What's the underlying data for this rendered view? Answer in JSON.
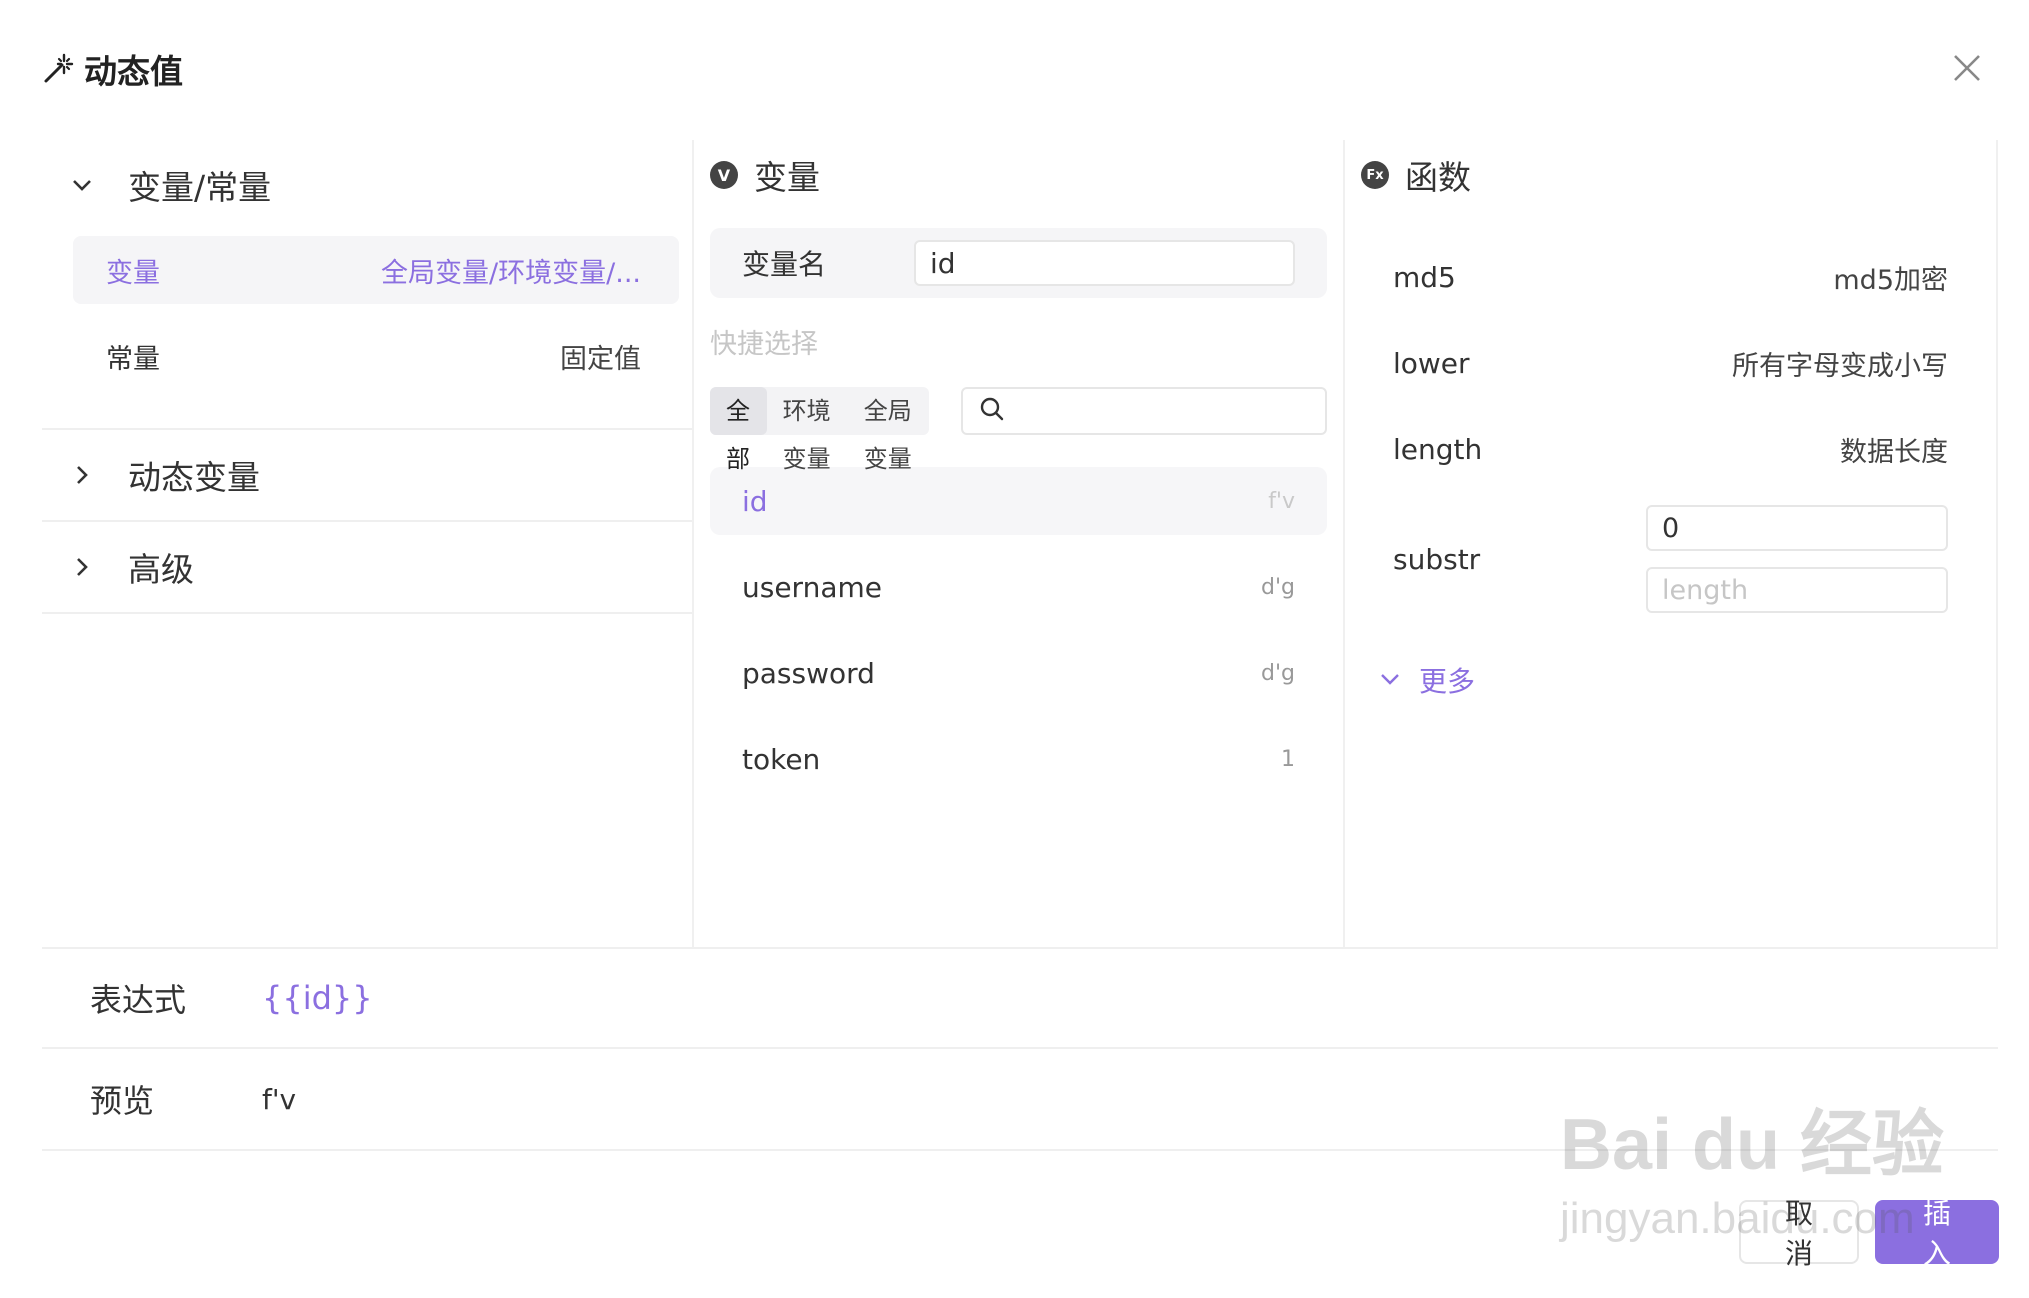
{
  "dialog": {
    "title": "动态值",
    "close_icon": "close-icon",
    "wand_icon": "magic-wand-icon"
  },
  "left": {
    "sections": [
      {
        "label": "变量/常量",
        "expanded": true
      },
      {
        "label": "动态变量",
        "expanded": false
      },
      {
        "label": "高级",
        "expanded": false
      }
    ],
    "items": [
      {
        "label": "变量",
        "sub": "全局变量/环境变量/...",
        "active": true
      },
      {
        "label": "常量",
        "sub": "固定值",
        "active": false
      }
    ]
  },
  "middle": {
    "title": "变量",
    "badge": "V",
    "var_name_label": "变量名",
    "var_name_value": "id",
    "quick_select": "快捷选择",
    "filters": [
      "全部",
      "环境变量",
      "全局变量"
    ],
    "active_filter": "全部",
    "search_placeholder": "",
    "vars": [
      {
        "name": "id",
        "value": "f'v",
        "active": true
      },
      {
        "name": "username",
        "value": "d'g",
        "active": false
      },
      {
        "name": "password",
        "value": "d'g",
        "active": false
      },
      {
        "name": "token",
        "value": "1",
        "active": false
      }
    ]
  },
  "right": {
    "title": "函数",
    "badge": "Fx",
    "functions": [
      {
        "name": "md5",
        "desc": "md5加密"
      },
      {
        "name": "lower",
        "desc": "所有字母变成小写"
      },
      {
        "name": "length",
        "desc": "数据长度"
      }
    ],
    "substr": {
      "name": "substr",
      "start_value": "0",
      "length_placeholder": "length"
    },
    "more": "更多"
  },
  "expression": {
    "label": "表达式",
    "value": "{{id}}"
  },
  "preview": {
    "label": "预览",
    "value": "f'v"
  },
  "footer": {
    "cancel": "取 消",
    "ok": "插 入"
  },
  "watermark": {
    "brand": "Bai du 经验",
    "url": "jingyan.baidu.com"
  },
  "colors": {
    "accent": "#8b6fe0",
    "border": "#e6e6e6",
    "active_bg": "#f5f5f7"
  }
}
